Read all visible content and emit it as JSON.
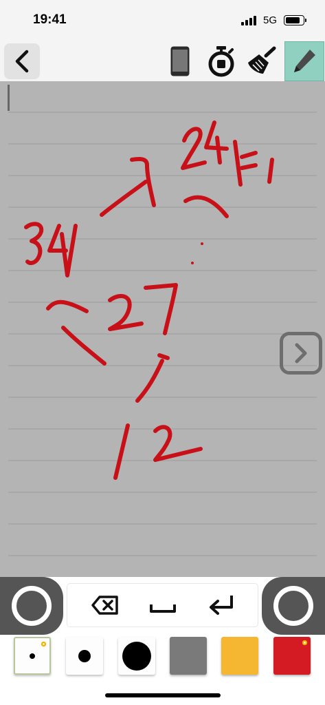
{
  "status_bar": {
    "time": "19:41",
    "network": "5G",
    "signal_bars_filled": 4,
    "battery_level": 0.85
  },
  "toolbar": {
    "back_icon": "chevron-left-icon",
    "tools": [
      {
        "name": "phone-icon",
        "active": false
      },
      {
        "name": "timer-icon",
        "active": false
      },
      {
        "name": "broom-icon",
        "active": false
      },
      {
        "name": "pen-icon",
        "active": true
      }
    ]
  },
  "canvas": {
    "background": "#b4b4b4",
    "line_color": "#9a9a9a",
    "ink_color": "#c81018",
    "handwriting": [
      "34",
      "27",
      "12",
      "24"
    ],
    "next_icon": "chevron-right-icon"
  },
  "keys": {
    "backspace_icon": "backspace-icon",
    "space_icon": "space-icon",
    "enter_icon": "enter-icon"
  },
  "palette": {
    "pens": [
      {
        "name": "pen-small",
        "selected": true
      },
      {
        "name": "pen-medium",
        "selected": false
      },
      {
        "name": "pen-large",
        "selected": false
      }
    ],
    "colors": [
      {
        "name": "gray",
        "hex": "#7a7a7a",
        "selected": false
      },
      {
        "name": "orange",
        "hex": "#f5b631",
        "selected": false
      },
      {
        "name": "red",
        "hex": "#d41a23",
        "selected": true
      }
    ]
  }
}
